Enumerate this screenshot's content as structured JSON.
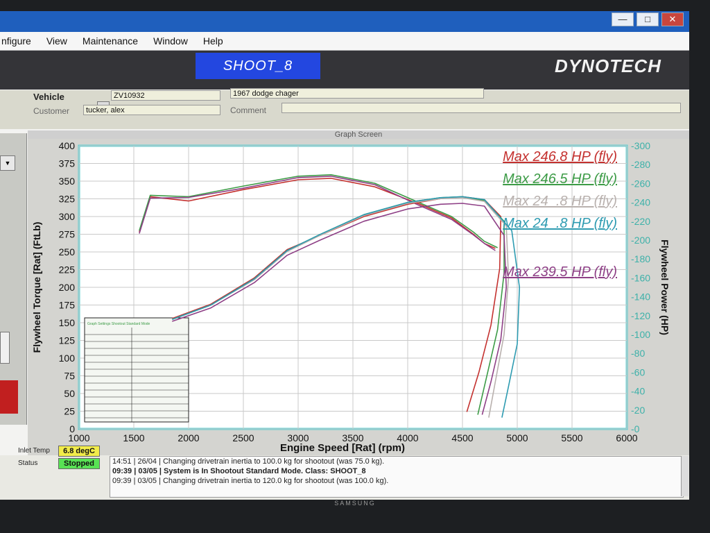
{
  "window": {
    "minimize_glyph": "—",
    "maximize_glyph": "□",
    "close_glyph": "✕"
  },
  "menu": [
    "nfigure",
    "View",
    "Maintenance",
    "Window",
    "Help"
  ],
  "header": {
    "mode_title": "SHOOT_8",
    "brand": "DYNOTECH"
  },
  "vehicle": {
    "vehicle_label": "Vehicle",
    "vehicle_id": "ZV10932",
    "description": "1967 dodge chager",
    "customer_label": "Customer",
    "customer": "tucker, alex",
    "comment_label": "Comment",
    "comment": ""
  },
  "graph_screen_label": "Graph Screen",
  "chart_data": {
    "type": "line",
    "xlabel": "Engine Speed [Rat] (rpm)",
    "ylabel_left": "Flywheel Torque [Rat] (FtLb)",
    "ylabel_right": "Flywheel Power (HP)",
    "xlim": [
      1000,
      6000
    ],
    "ylim_left": [
      0,
      400
    ],
    "ylim_right": [
      0,
      300
    ],
    "x_ticks": [
      1000,
      1500,
      2000,
      2500,
      3000,
      3500,
      4000,
      4500,
      5000,
      5500,
      6000
    ],
    "y_left_ticks": [
      0,
      25,
      50,
      75,
      100,
      125,
      150,
      175,
      200,
      225,
      250,
      275,
      300,
      325,
      350,
      375,
      400
    ],
    "y_right_ticks": [
      0,
      20,
      40,
      60,
      80,
      100,
      120,
      140,
      160,
      180,
      200,
      220,
      240,
      260,
      280,
      300
    ],
    "legend": [
      {
        "label": "Max 246.8 HP (fly)",
        "color": "#c4312f"
      },
      {
        "label": "Max 246.5 HP (fly)",
        "color": "#3c9b46"
      },
      {
        "label": "Max 24_.8 HP (fly)",
        "color": "#b9b1ae"
      },
      {
        "label": "Max 24_.8 HP (fly)",
        "color": "#2d9bb1"
      },
      {
        "label": "Max 239.5 HP (fly)",
        "color": "#8e3f86"
      }
    ],
    "power_runs": [
      {
        "color": "#c4312f",
        "axis": "right",
        "x": [
          1850,
          2200,
          2600,
          2900,
          3200,
          3600,
          4000,
          4300,
          4500,
          4700,
          4850,
          4840,
          4760,
          4650,
          4540
        ],
        "y": [
          117,
          132,
          160,
          190,
          205,
          225,
          238,
          244,
          246,
          243,
          225,
          170,
          110,
          60,
          18
        ]
      },
      {
        "color": "#3c9b46",
        "axis": "right",
        "x": [
          1850,
          2200,
          2600,
          2900,
          3200,
          3600,
          4000,
          4300,
          4500,
          4700,
          4880,
          4880,
          4820,
          4720,
          4640
        ],
        "y": [
          116,
          131,
          159,
          189,
          206,
          227,
          240,
          245,
          246,
          242,
          220,
          165,
          105,
          55,
          15
        ]
      },
      {
        "color": "#b9b1ae",
        "axis": "right",
        "x": [
          1850,
          2200,
          2600,
          2900,
          3200,
          3600,
          4000,
          4300,
          4500,
          4700,
          4900,
          4920,
          4880,
          4800,
          4740
        ],
        "y": [
          116,
          131,
          158,
          188,
          205,
          226,
          239,
          244,
          245,
          241,
          215,
          160,
          100,
          50,
          12
        ]
      },
      {
        "color": "#2d9bb1",
        "axis": "right",
        "x": [
          1850,
          2200,
          2600,
          2900,
          3200,
          3600,
          4000,
          4300,
          4500,
          4700,
          4950,
          5020,
          5000,
          4920,
          4860
        ],
        "y": [
          116,
          131,
          159,
          189,
          206,
          227,
          240,
          245,
          246,
          243,
          210,
          150,
          90,
          45,
          12
        ]
      },
      {
        "color": "#8e3f86",
        "axis": "right",
        "x": [
          1850,
          2200,
          2600,
          2900,
          3200,
          3600,
          4000,
          4300,
          4500,
          4700,
          4880,
          4900,
          4850,
          4760,
          4680
        ],
        "y": [
          114,
          128,
          155,
          184,
          200,
          220,
          233,
          238,
          239,
          236,
          205,
          150,
          95,
          50,
          15
        ]
      }
    ],
    "torque_runs": [
      {
        "color": "#c4312f",
        "axis": "left",
        "x": [
          1550,
          1650,
          2000,
          2500,
          3000,
          3300,
          3700,
          4100,
          4400,
          4600,
          4700,
          4800
        ],
        "y": [
          278,
          328,
          322,
          338,
          352,
          354,
          342,
          318,
          298,
          275,
          262,
          255
        ]
      },
      {
        "color": "#3c9b46",
        "axis": "left",
        "x": [
          1550,
          1650,
          2000,
          2500,
          3000,
          3300,
          3700,
          4100,
          4400,
          4600,
          4700,
          4820
        ],
        "y": [
          280,
          330,
          328,
          343,
          357,
          359,
          347,
          320,
          300,
          278,
          265,
          256
        ]
      },
      {
        "color": "#8e3f86",
        "axis": "left",
        "x": [
          1550,
          1650,
          2000,
          2500,
          3000,
          3300,
          3700,
          4100,
          4400,
          4600,
          4700,
          4800
        ],
        "y": [
          276,
          326,
          327,
          340,
          355,
          357,
          345,
          316,
          296,
          274,
          262,
          252
        ]
      }
    ]
  },
  "runs_table_header": "Graph Settings Shootout Standard Mode",
  "status": {
    "inlet_label": "Inlet Temp",
    "inlet_value": "6.8 degC",
    "status_label": "Status",
    "status_value": "Stopped"
  },
  "log": [
    "14:51 | 26/04 | Changing drivetrain inertia to 100.0 kg for shootout (was 75.0 kg).",
    "09:39 | 03/05 | System is In Shootout Standard Mode. Class: SHOOT_8",
    "09:39 | 03/05 | Changing drivetrain inertia to 120.0 kg for shootout (was 100.0 kg)."
  ],
  "bezel_brand": "SAMSUNG",
  "colors": {
    "plot_bg": "#ffffff",
    "plot_border": "#5fd0d2",
    "grid": "#c9c9c9",
    "right_axis": "#3db1a9"
  }
}
